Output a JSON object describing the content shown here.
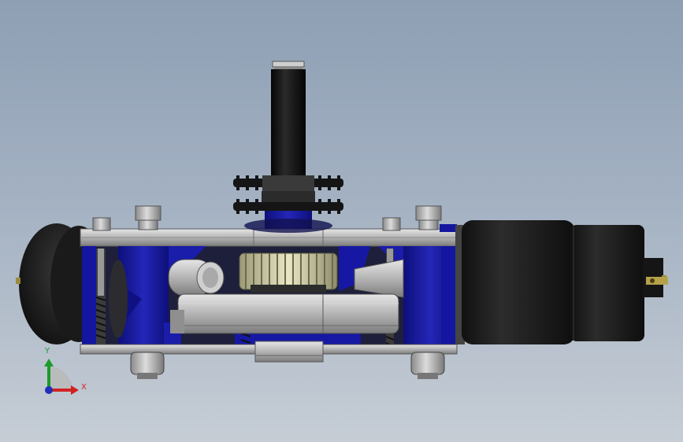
{
  "viewport": {
    "background_top": "#8e9fb4",
    "background_bottom": "#c6cdd5"
  },
  "model": {
    "frame_color": "#1d1fa8",
    "steel_color": "#b9b9b9",
    "motor_color": "#222222"
  },
  "triad": {
    "y_label": "Y",
    "x_label": "X",
    "y_color": "#1a9b2a",
    "x_color": "#d12222",
    "z_color": "#1f2fb8"
  }
}
